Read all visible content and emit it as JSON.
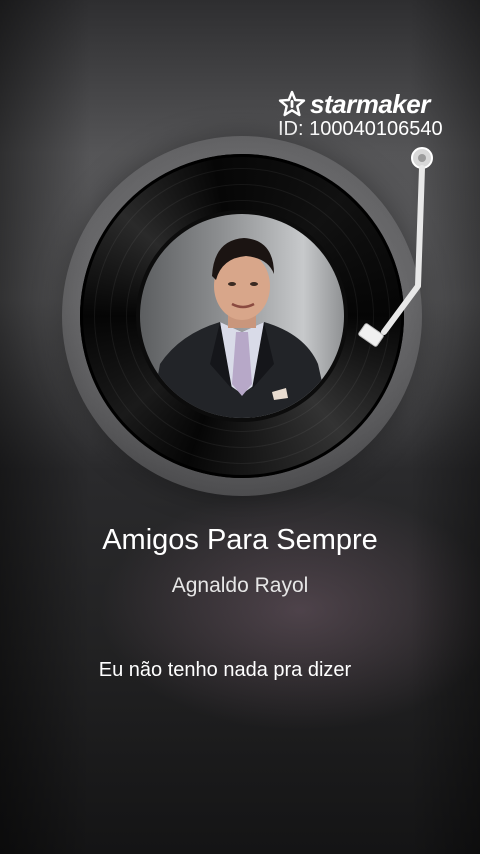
{
  "watermark": {
    "brand": "starmaker",
    "brand_icon": "starmaker-logo-icon",
    "id_line": "ID: 100040106540"
  },
  "player": {
    "disc_icon": "vinyl-record",
    "cover_description_icon": "album-cover-portrait",
    "tonearm_icon": "tonearm"
  },
  "song": {
    "title": "Amigos Para Sempre",
    "artist": "Agnaldo Rayol"
  },
  "lyrics": {
    "current_line": "Eu não tenho nada pra dizer"
  },
  "colors": {
    "text_primary": "#ffffff",
    "text_secondary": "#e6e6e6"
  }
}
